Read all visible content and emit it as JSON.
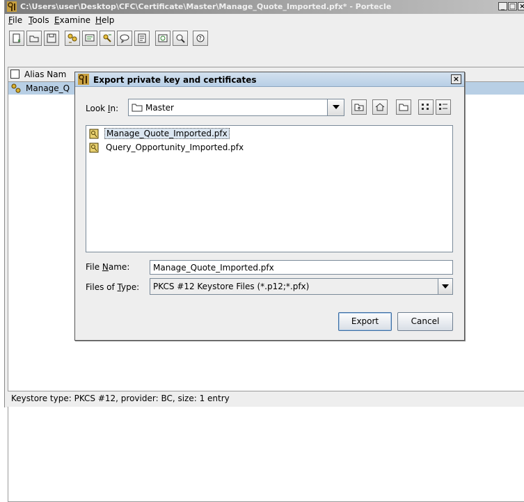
{
  "window": {
    "title": "C:\\Users\\user\\Desktop\\CFC\\Certificate\\Master\\Manage_Quote_Imported.pfx* - Portecle",
    "minimize_glyph": "_",
    "maximize_glyph": "□",
    "close_glyph": "×"
  },
  "menu": {
    "items": [
      {
        "mnemonic": "F",
        "rest": "ile"
      },
      {
        "mnemonic": "T",
        "rest": "ools"
      },
      {
        "mnemonic": "E",
        "rest": "xamine"
      },
      {
        "mnemonic": "H",
        "rest": "elp"
      }
    ]
  },
  "toolbar": {
    "icons": [
      "new-keystore-icon",
      "open-keystore-icon",
      "save-keystore-icon",
      "generate-key-pair-icon",
      "import-trusted-certificate-icon",
      "import-key-pair-icon",
      "set-keystore-password-icon",
      "keystore-report-icon",
      "examine-certificate-icon",
      "examine-crl-icon",
      "help-icon"
    ]
  },
  "table": {
    "column_alias": "Alias Nam",
    "rows": [
      {
        "alias": "Manage_Q",
        "selected": true
      }
    ]
  },
  "status": {
    "text": "Keystore type: PKCS #12, provider: BC, size: 1 entry"
  },
  "dialog": {
    "title": "Export private key and certificates",
    "close_glyph": "×",
    "look_in": {
      "mnemonic": "I",
      "pre": "Look ",
      "post": "n:",
      "value": "Master"
    },
    "files": [
      {
        "name": "Manage_Quote_Imported.pfx",
        "selected": true
      },
      {
        "name": "Query_Opportunity_Imported.pfx",
        "selected": false
      }
    ],
    "file_name": {
      "pre": "File ",
      "mnemonic": "N",
      "post": "ame:",
      "value": "Manage_Quote_Imported.pfx"
    },
    "file_type": {
      "pre": "Files of ",
      "mnemonic": "T",
      "post": "ype:",
      "value": "PKCS #12 Keystore Files (*.p12;*.pfx)"
    },
    "export_label": "Export",
    "cancel_label": "Cancel"
  },
  "colors": {
    "selection": "#b8cfe5",
    "dialog_title": "#c6d8ea",
    "focus": "#3d6ea3"
  }
}
